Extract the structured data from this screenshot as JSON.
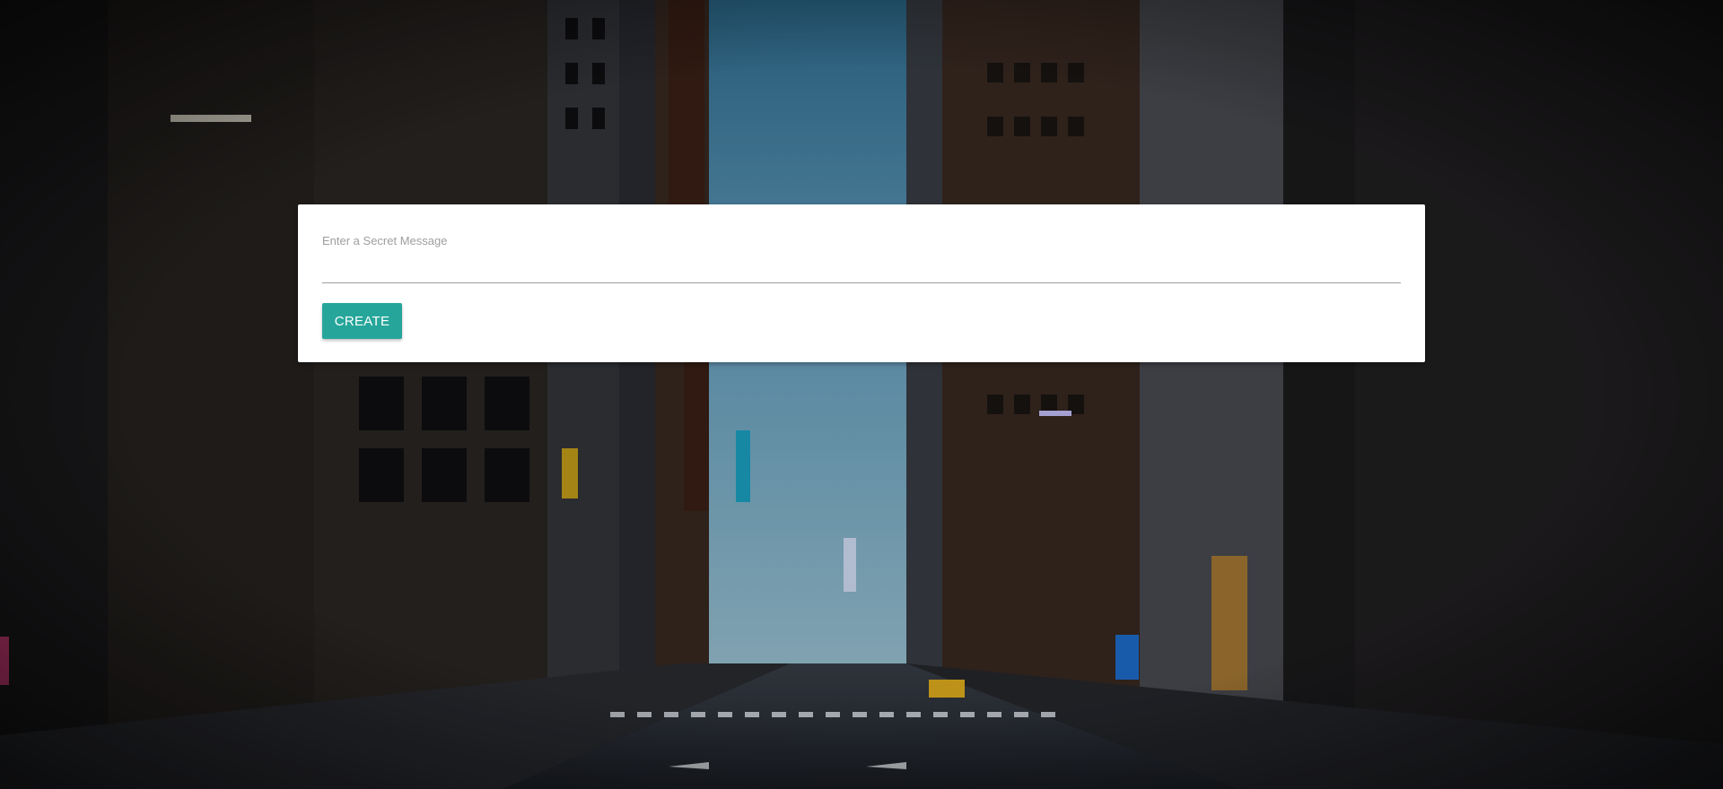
{
  "form": {
    "message_label": "Enter a Secret Message",
    "message_value": "",
    "create_label": "CREATE"
  },
  "background": {
    "subject": "city-street-night-photo",
    "sky_color": "#5a96b8",
    "accent_color": "#26a69a"
  }
}
